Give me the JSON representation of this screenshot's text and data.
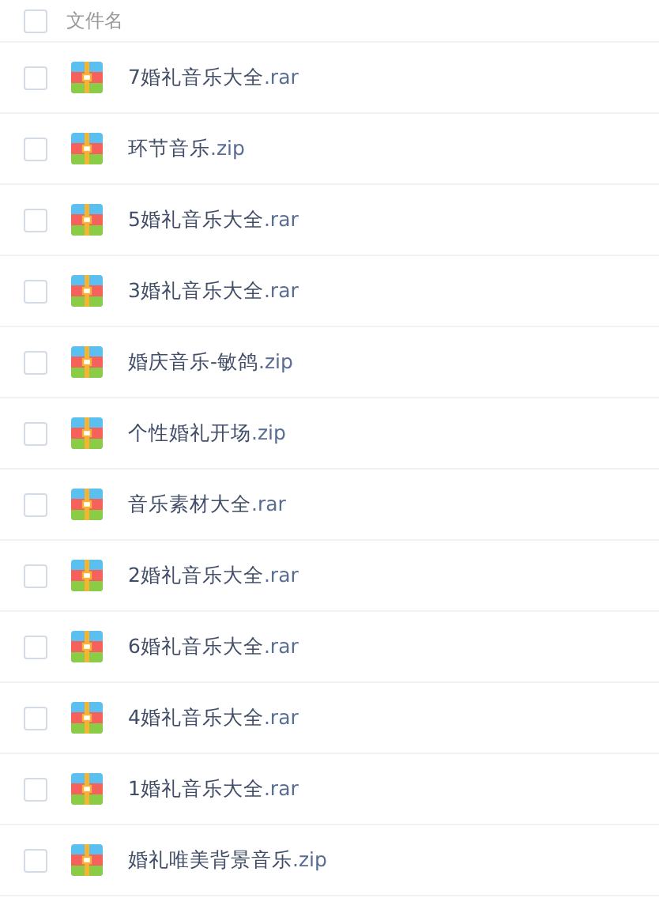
{
  "header": {
    "label": "文件名",
    "selected": false
  },
  "files": [
    {
      "name": "7婚礼音乐大全",
      "ext": ".rar",
      "selected": false
    },
    {
      "name": "环节音乐",
      "ext": ".zip",
      "selected": false
    },
    {
      "name": "5婚礼音乐大全",
      "ext": ".rar",
      "selected": false
    },
    {
      "name": "3婚礼音乐大全",
      "ext": ".rar",
      "selected": false
    },
    {
      "name": "婚庆音乐-敏鸽",
      "ext": ".zip",
      "selected": false
    },
    {
      "name": "个性婚礼开场",
      "ext": ".zip",
      "selected": false
    },
    {
      "name": "音乐素材大全",
      "ext": ".rar",
      "selected": false
    },
    {
      "name": "2婚礼音乐大全",
      "ext": ".rar",
      "selected": false
    },
    {
      "name": "6婚礼音乐大全",
      "ext": ".rar",
      "selected": false
    },
    {
      "name": "4婚礼音乐大全",
      "ext": ".rar",
      "selected": false
    },
    {
      "name": "1婚礼音乐大全",
      "ext": ".rar",
      "selected": false
    },
    {
      "name": "婚礼唯美背景音乐",
      "ext": ".zip",
      "selected": false
    }
  ]
}
